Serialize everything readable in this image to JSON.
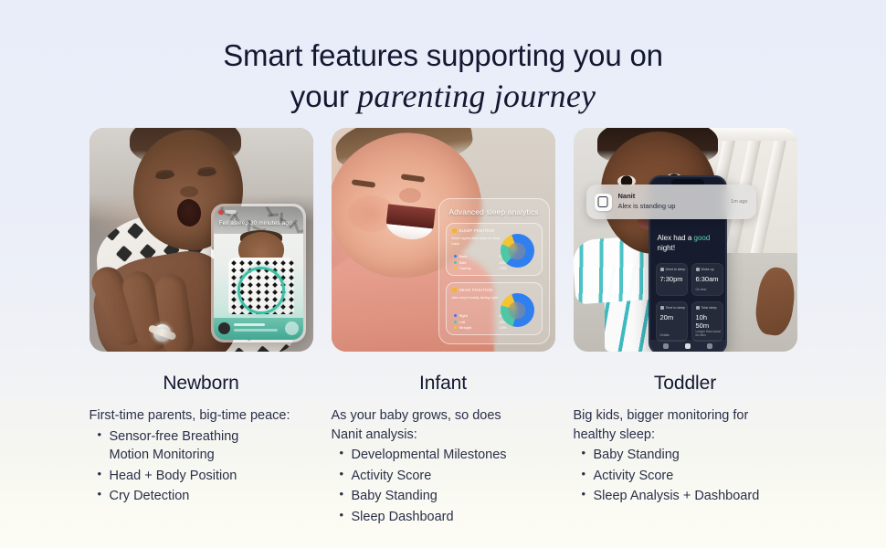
{
  "headline": {
    "line1": "Smart features supporting you on",
    "line2_plain": "your ",
    "line2_italic": "parenting journey"
  },
  "theme": {
    "bg_top": "#e9edf9",
    "bg_bottom": "#fcfcf5",
    "text": "#141830",
    "accent_teal": "#3fbfa4",
    "accent_green": "#5fd3b2",
    "donut_blue": "#2f7ff0",
    "donut_yellow": "#f5c430",
    "donut_teal": "#4cc8a8"
  },
  "columns": [
    {
      "id": "newborn",
      "title": "Newborn",
      "intro": "First-time parents, big-time peace:",
      "bullets": [
        {
          "text": "Sensor-free Breathing",
          "cont": "Motion Monitoring"
        },
        {
          "text": "Head + Body Position",
          "cont": ""
        },
        {
          "text": "Cry Detection",
          "cont": ""
        }
      ],
      "image": {
        "alt": "Newborn swaddled in a white blanket with black diamond print, held by a parent's hand",
        "overlay": {
          "type": "phone-live-view",
          "status_text": "Fell asleep 30 minutes ago",
          "breathing_circle": true
        }
      }
    },
    {
      "id": "infant",
      "title": "Infant",
      "intro_line1": "As your baby grows, so does",
      "intro_line2": "Nanit analysis:",
      "bullets": [
        {
          "text": "Developmental Milestones",
          "cont": ""
        },
        {
          "text": "Activity Score",
          "cont": ""
        },
        {
          "text": "Baby Standing",
          "cont": ""
        },
        {
          "text": "Sleep Dashboard",
          "cont": ""
        }
      ],
      "image": {
        "alt": "Smiling infant lying down in warm pink light",
        "overlay": {
          "type": "glass-panel",
          "title": "Advanced sleep analytics",
          "cards": [
            {
              "label": "SLEEP POSITION",
              "desc": "Most nights Alex slept on their back",
              "legend": [
                {
                  "name": "Back",
                  "value": "67%",
                  "color": "#2f7ff0"
                },
                {
                  "name": "Side",
                  "value": "20%",
                  "color": "#4cc8a8"
                },
                {
                  "name": "Tummy",
                  "value": "13%",
                  "color": "#f5c430"
                }
              ]
            },
            {
              "label": "HEAD POSITION",
              "desc": "Alex slept mostly facing right",
              "legend": [
                {
                  "name": "Right",
                  "value": "60%",
                  "color": "#2f7ff0"
                },
                {
                  "name": "Left",
                  "value": "25%",
                  "color": "#4cc8a8"
                },
                {
                  "name": "Straight",
                  "value": "15%",
                  "color": "#f5c430"
                }
              ]
            }
          ]
        }
      }
    },
    {
      "id": "toddler",
      "title": "Toddler",
      "intro_line1": "Big kids, bigger monitoring for",
      "intro_line2": "healthy sleep:",
      "bullets": [
        {
          "text": "Baby Standing",
          "cont": ""
        },
        {
          "text": "Activity Score",
          "cont": ""
        },
        {
          "text": "Sleep Analysis + Dashboard",
          "cont": ""
        }
      ],
      "image": {
        "alt": "Toddler standing in a white crib wearing teal striped clothing",
        "notification": {
          "app": "Nanit",
          "message": "Alex is standing up",
          "time": "1m ago"
        },
        "phone": {
          "title_plain_1": "Alex had a ",
          "title_accent": "good",
          "title_plain_2": " night!",
          "tiles": [
            {
              "label": "Went to sleep",
              "value": "7:30pm",
              "sub": ""
            },
            {
              "label": "Woke up",
              "value": "6:30am",
              "sub": "On time"
            },
            {
              "label": "Time to sleep",
              "value": "20m",
              "sub": "Details"
            },
            {
              "label": "Total sleep",
              "value": "10h 50m",
              "sub": "Longer than usual for Alex"
            }
          ]
        }
      }
    }
  ]
}
